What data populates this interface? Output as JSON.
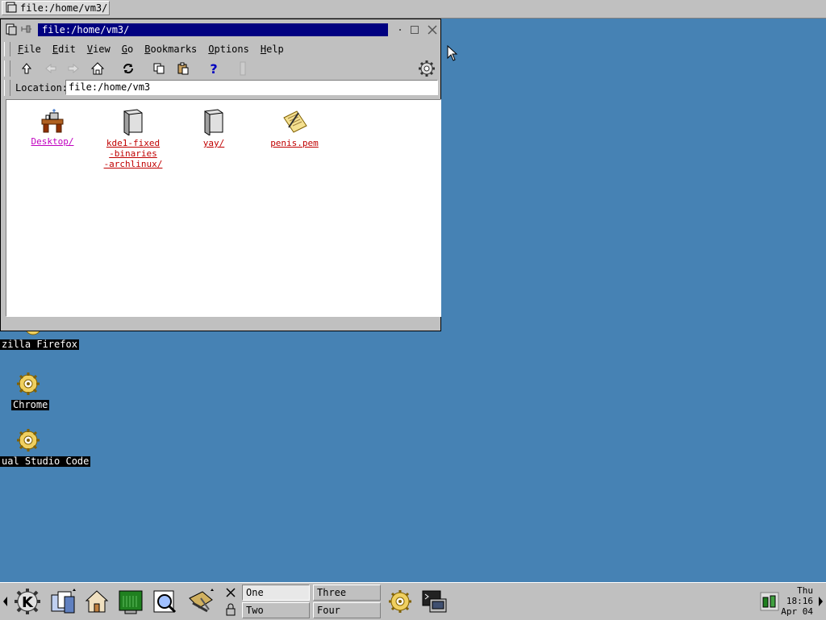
{
  "taskbar": {
    "task_title": "file:/home/vm3/"
  },
  "desktop": {
    "icons": [
      {
        "label": "zilla Firefox"
      },
      {
        "label": "Chrome"
      },
      {
        "label": "ual Studio Code"
      }
    ]
  },
  "window": {
    "title": "file:/home/vm3/",
    "menu": [
      "File",
      "Edit",
      "View",
      "Go",
      "Bookmarks",
      "Options",
      "Help"
    ],
    "menu_accels": [
      "F",
      "E",
      "V",
      "G",
      "B",
      "O",
      "H"
    ],
    "toolbar": [
      "up-icon",
      "back-icon",
      "forward-icon",
      "home-icon",
      "reload-icon",
      "copy-icon",
      "paste-icon",
      "help-icon",
      "stop-icon",
      "settings-gear-icon"
    ],
    "location_label": "Location:",
    "location_value": "file:/home/vm3",
    "files": [
      {
        "name": "Desktop/",
        "visited": true,
        "icon": "desk-icon"
      },
      {
        "name_lines": [
          "kde1-fixed",
          "-binaries",
          "-archlinux/"
        ],
        "icon": "folder-icon"
      },
      {
        "name": "yay/",
        "icon": "folder-icon"
      },
      {
        "name": "penis.pem",
        "icon": "document-icon"
      }
    ]
  },
  "panel": {
    "desktops": [
      "One",
      "Two",
      "Three",
      "Four"
    ],
    "active_desktop": "One",
    "clock": {
      "day": "Thu",
      "time": "18:16",
      "date": "Apr 04"
    }
  },
  "colors": {
    "desktop_bg": "#4682b4",
    "titlebar_active": "#000080",
    "link": "#c00000",
    "link_visited": "#c000c0"
  }
}
